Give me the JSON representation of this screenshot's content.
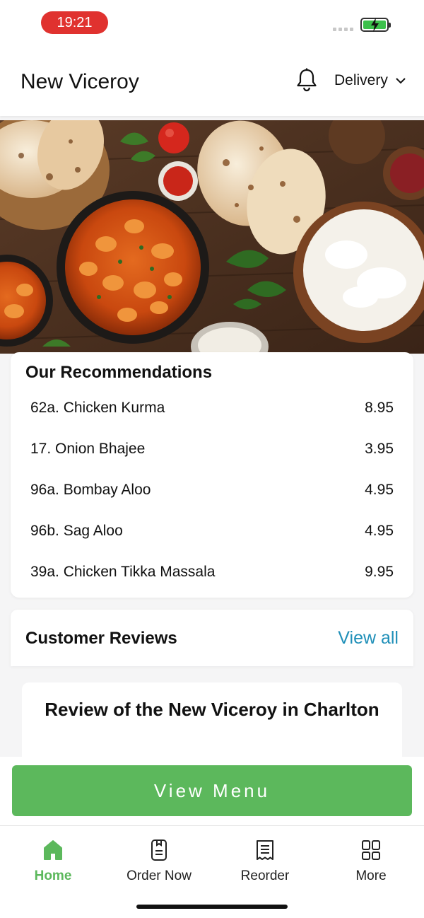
{
  "status_bar": {
    "time": "19:21"
  },
  "header": {
    "title": "New Viceroy",
    "delivery_mode": "Delivery"
  },
  "recommendations": {
    "title": "Our Recommendations",
    "items": [
      {
        "name": "62a. Chicken Kurma",
        "price": "8.95"
      },
      {
        "name": "17. Onion Bhajee",
        "price": "3.95"
      },
      {
        "name": "96a. Bombay Aloo",
        "price": "4.95"
      },
      {
        "name": "96b. Sag Aloo",
        "price": "4.95"
      },
      {
        "name": "39a. Chicken Tikka Massala",
        "price": "9.95"
      }
    ]
  },
  "reviews": {
    "title": "Customer Reviews",
    "view_all_label": "View all",
    "first_review_title": "Review of the New Viceroy in Charlton"
  },
  "view_menu_label": "View Menu",
  "tabs": [
    {
      "label": "Home",
      "icon": "home-icon",
      "active": true
    },
    {
      "label": "Order Now",
      "icon": "order-icon",
      "active": false
    },
    {
      "label": "Reorder",
      "icon": "receipt-icon",
      "active": false
    },
    {
      "label": "More",
      "icon": "grid-icon",
      "active": false
    }
  ],
  "colors": {
    "accent_green": "#5cb85c",
    "link_blue": "#1f8fb8",
    "time_pill_red": "#e0322f"
  }
}
